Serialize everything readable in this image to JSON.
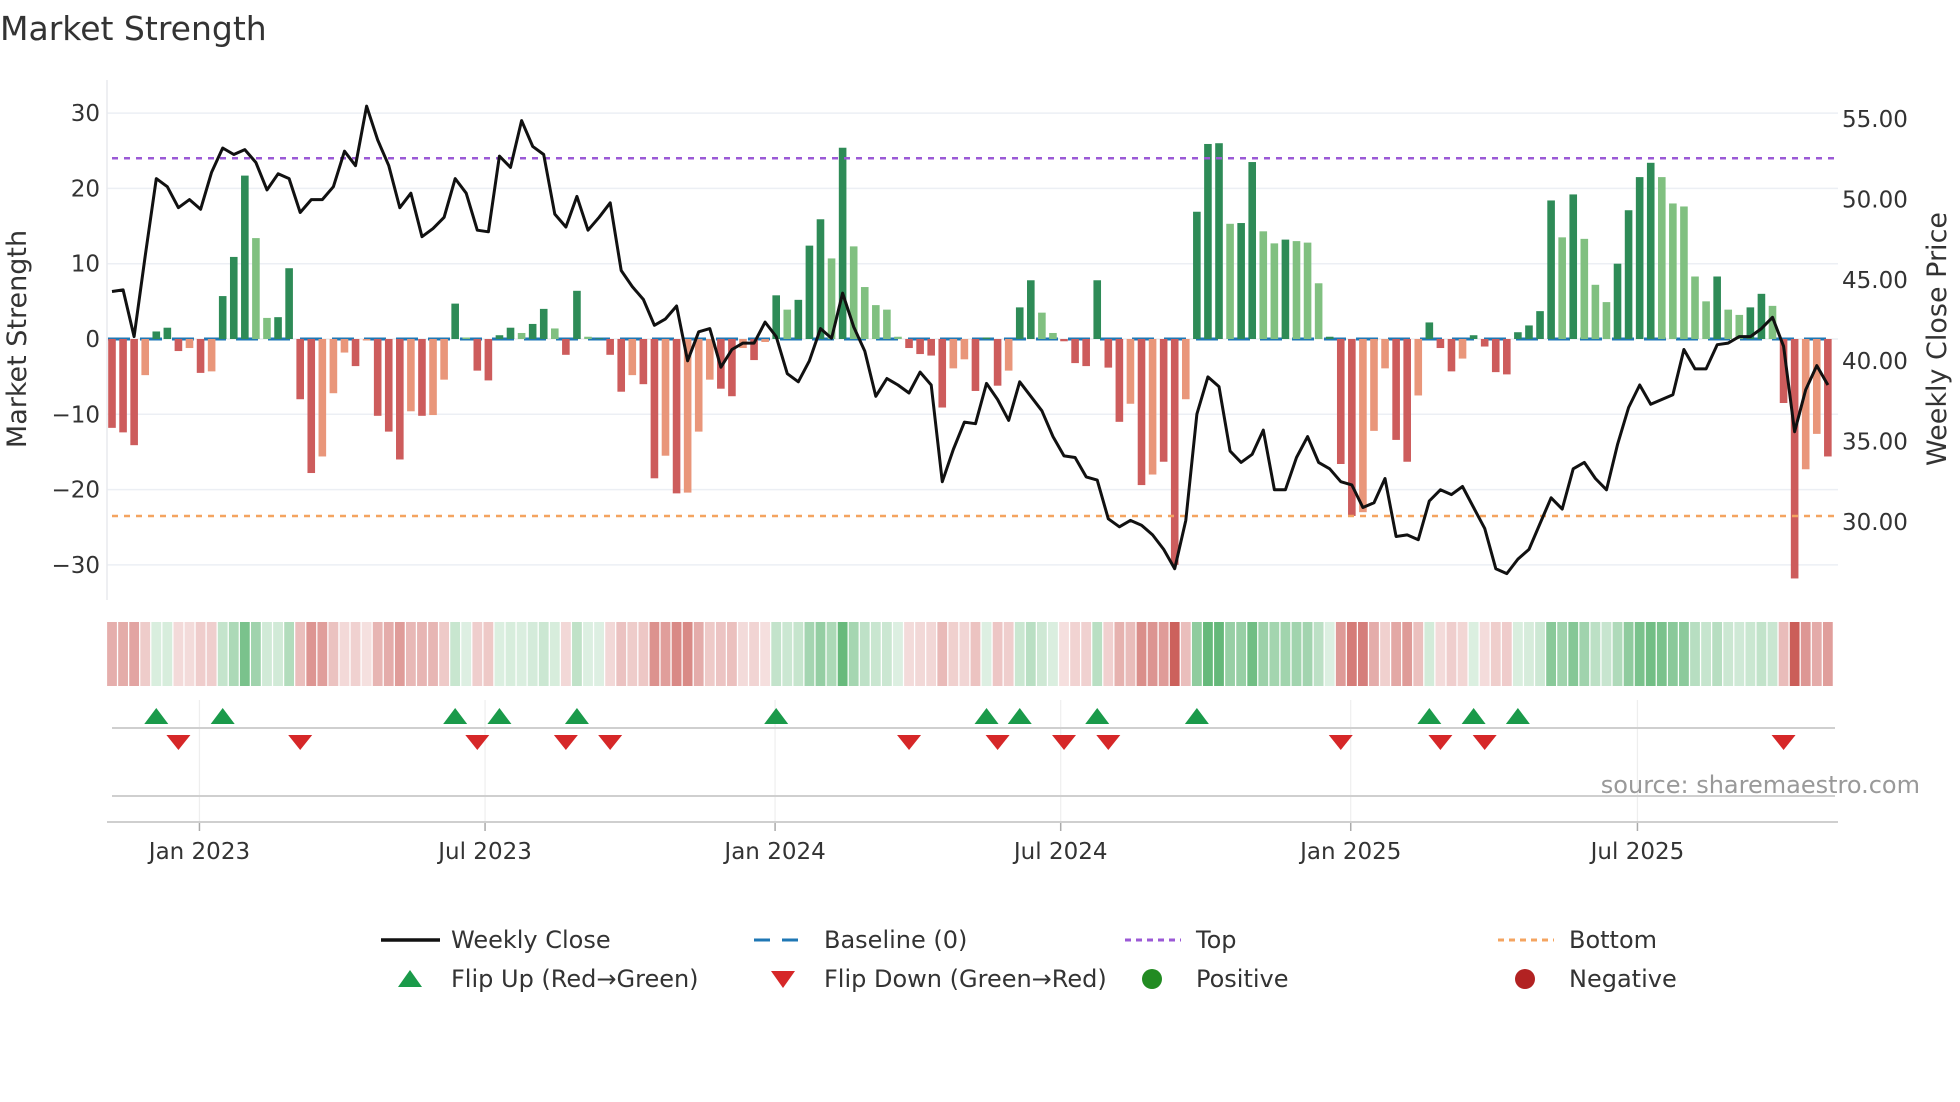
{
  "chart_data": {
    "type": "bar",
    "title": "Market Strength",
    "ylabel": "Market Strength",
    "y2label": "Weekly Close Price",
    "ylim": [
      -34,
      37
    ],
    "yticks": [
      -30,
      -20,
      -10,
      0,
      10,
      20,
      30
    ],
    "ytick_labels": [
      "−30",
      "−20",
      "−10",
      "0",
      "10",
      "20",
      "30"
    ],
    "y2ticks": [
      30,
      35,
      40,
      45,
      50,
      55
    ],
    "y2tick_labels": [
      "30.00",
      "35.00",
      "40.00",
      "45.00",
      "50.00",
      "55.00"
    ],
    "x_unit": "week index",
    "xticks": [
      7.9,
      33.7,
      59.9,
      85.7,
      111.9,
      137.8
    ],
    "xtick_labels": [
      "Jan 2023",
      "Jul 2023",
      "Jan 2024",
      "Jul 2024",
      "Jan 2025",
      "Jul 2025"
    ],
    "top_level": 24,
    "bottom_level": -23.5,
    "baseline": 0,
    "strength": [
      -11.8,
      -12.4,
      -14.1,
      -4.8,
      1.0,
      1.5,
      -1.6,
      -1.2,
      -4.5,
      -4.3,
      5.7,
      10.9,
      21.7,
      13.4,
      2.8,
      2.9,
      9.4,
      -8.0,
      -17.8,
      -15.6,
      -7.2,
      -1.8,
      -3.6,
      -0.2,
      -10.2,
      -12.3,
      -16.0,
      -9.6,
      -10.2,
      -10.1,
      -5.4,
      4.7,
      0.2,
      -4.2,
      -5.5,
      0.5,
      1.5,
      0.8,
      2.0,
      4.0,
      1.4,
      -2.1,
      6.4,
      0.3,
      0.1,
      -2.1,
      -7.0,
      -4.8,
      -6.0,
      -18.5,
      -15.5,
      -20.5,
      -20.4,
      -12.3,
      -5.4,
      -6.6,
      -7.6,
      -1.2,
      -2.8,
      -0.4,
      5.8,
      3.9,
      5.2,
      12.4,
      15.9,
      10.7,
      25.4,
      12.3,
      6.9,
      4.5,
      3.9,
      0.3,
      -1.2,
      -2.0,
      -2.2,
      -9.1,
      -3.9,
      -2.7,
      -6.9,
      0.2,
      -6.2,
      -4.2,
      4.2,
      7.8,
      3.5,
      0.8,
      -0.3,
      -3.2,
      -3.6,
      7.8,
      -3.8,
      -11.0,
      -8.6,
      -19.4,
      -18.0,
      -16.3,
      -30.0,
      -8.0,
      16.9,
      25.9,
      26.0,
      15.3,
      15.4,
      23.5,
      14.3,
      12.7,
      13.2,
      13.0,
      12.8,
      7.4,
      0.3,
      -16.6,
      -23.5,
      -23.0,
      -12.2,
      -3.9,
      -13.4,
      -16.3,
      -7.5,
      2.2,
      -1.2,
      -4.3,
      -2.6,
      0.5,
      -1.0,
      -4.4,
      -4.7,
      0.9,
      1.8,
      3.7,
      18.4,
      13.5,
      19.2,
      13.3,
      7.2,
      4.9,
      10.0,
      17.1,
      21.5,
      23.4,
      21.5,
      18.0,
      17.6,
      8.3,
      5.0,
      8.3,
      3.9,
      3.2,
      4.2,
      6.0,
      4.4,
      -8.5,
      -31.8,
      -17.3,
      -12.6,
      -15.6
    ],
    "weakening_weeks": [
      3,
      7,
      9,
      13,
      14,
      19,
      20,
      21,
      23,
      27,
      29,
      30,
      32,
      37,
      40,
      43,
      47,
      50,
      52,
      53,
      54,
      57,
      59,
      61,
      65,
      67,
      68,
      69,
      70,
      71,
      76,
      77,
      81,
      84,
      85,
      92,
      94,
      97,
      101,
      104,
      105,
      107,
      108,
      109,
      113,
      114,
      115,
      118,
      122,
      131,
      133,
      134,
      135,
      140,
      141,
      142,
      143,
      144,
      146,
      147,
      150,
      153,
      154
    ],
    "weekly_close": [
      44.3,
      44.4,
      41.5,
      46.5,
      51.3,
      50.8,
      49.5,
      50.0,
      49.4,
      51.7,
      53.2,
      52.8,
      53.1,
      52.3,
      50.6,
      51.6,
      51.3,
      49.2,
      50.0,
      50.0,
      50.8,
      53.0,
      52.1,
      55.8,
      53.7,
      52.1,
      49.5,
      50.4,
      47.7,
      48.2,
      48.9,
      51.3,
      50.4,
      48.1,
      48.0,
      52.7,
      52.0,
      54.9,
      53.3,
      52.8,
      49.1,
      48.3,
      50.2,
      48.1,
      48.9,
      49.8,
      45.6,
      44.6,
      43.8,
      42.2,
      42.6,
      43.4,
      40.0,
      41.8,
      42.0,
      39.6,
      40.7,
      41.1,
      41.1,
      42.4,
      41.5,
      39.2,
      38.7,
      40.0,
      42.0,
      41.4,
      44.2,
      42.1,
      40.6,
      37.8,
      38.9,
      38.5,
      38.0,
      39.3,
      38.5,
      32.5,
      34.5,
      36.2,
      36.1,
      38.6,
      37.6,
      36.3,
      38.7,
      37.8,
      36.9,
      35.3,
      34.1,
      34.0,
      32.8,
      32.6,
      30.2,
      29.7,
      30.1,
      29.8,
      29.2,
      28.3,
      27.1,
      30.1,
      36.7,
      39.0,
      38.4,
      34.4,
      33.7,
      34.2,
      35.7,
      32.0,
      32.0,
      34.0,
      35.3,
      33.7,
      33.3,
      32.5,
      32.3,
      30.9,
      31.2,
      32.7,
      29.1,
      29.2,
      28.9,
      31.3,
      32.0,
      31.7,
      32.2,
      30.9,
      29.6,
      27.1,
      26.8,
      27.7,
      28.3,
      29.9,
      31.5,
      30.8,
      33.3,
      33.7,
      32.7,
      32.0,
      34.8,
      37.1,
      38.5,
      37.3,
      37.6,
      37.9,
      40.7,
      39.5,
      39.5,
      41.0,
      41.1,
      41.5,
      41.5,
      42.0,
      42.7,
      40.9,
      35.6,
      38.2,
      39.7,
      38.5
    ],
    "flip_up_weeks": [
      4,
      10,
      31,
      35,
      42,
      60,
      79,
      82,
      89,
      98,
      119,
      123,
      127
    ],
    "flip_down_weeks": [
      6,
      17,
      33,
      41,
      45,
      72,
      80,
      86,
      90,
      111,
      120,
      124,
      151
    ],
    "legend": {
      "weekly_close": "Weekly Close",
      "baseline": "Baseline (0)",
      "top": "Top",
      "bottom": "Bottom",
      "flip_up": "Flip Up (Red→Green)",
      "flip_down": "Flip Down (Green→Red)",
      "positive": "Positive",
      "negative": "Negative"
    },
    "legend_placement": "bottom",
    "grid": true,
    "colors": {
      "green_strong": "#2e8b57",
      "green_weak": "#80c080",
      "red_strong": "#cd5c5c",
      "red_weak": "#e9967a",
      "line": "#111111",
      "baseline": "#1f77b4",
      "top": "#9b59d6",
      "bottom": "#f4a460",
      "flip_up": "#1a9a4a",
      "flip_down": "#d62728",
      "positive": "#228b22",
      "negative": "#b22222"
    }
  },
  "source": "source: sharemaestro.com"
}
